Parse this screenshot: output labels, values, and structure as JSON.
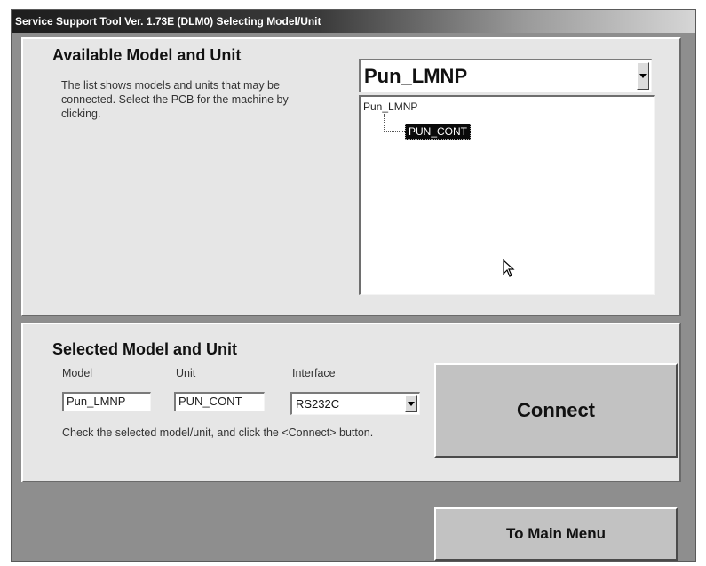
{
  "window": {
    "title": "Service Support Tool Ver. 1.73E (DLM0)   Selecting Model/Unit"
  },
  "available": {
    "title": "Available Model and Unit",
    "description": "The list shows models and units that may be connected. Select the PCB for the machine by clicking.",
    "model_select_value": "Pun_LMNP",
    "tree": {
      "root": "Pun_LMNP",
      "child": "PUN_CONT"
    }
  },
  "selected": {
    "title": "Selected Model and Unit",
    "model_label": "Model",
    "unit_label": "Unit",
    "interface_label": "Interface",
    "model_value": "Pun_LMNP",
    "unit_value": "PUN_CONT",
    "interface_value": "RS232C",
    "instruction": "Check the selected model/unit, and click the <Connect> button."
  },
  "buttons": {
    "connect": "Connect",
    "main_menu": "To Main Menu"
  },
  "icons": {
    "dropdown": "chevron-down-icon",
    "cursor": "mouse-pointer-icon"
  }
}
